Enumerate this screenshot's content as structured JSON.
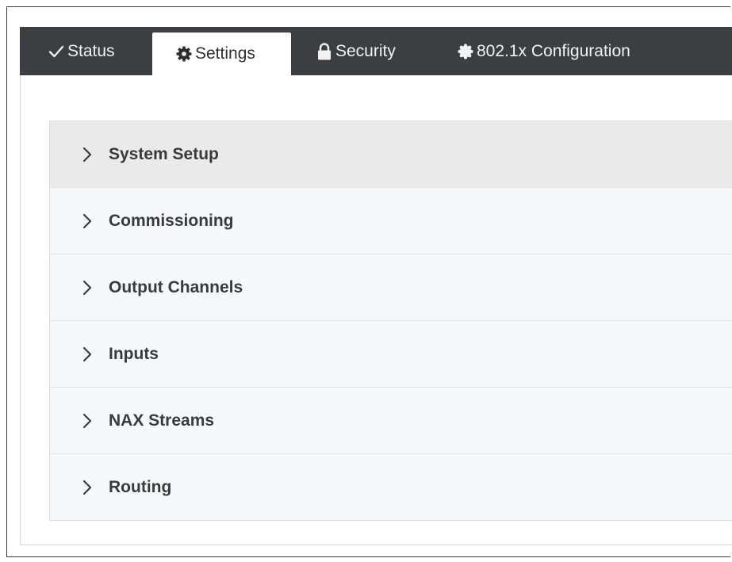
{
  "tabs": [
    {
      "label": "Status",
      "icon": "check-icon"
    },
    {
      "label": "Settings",
      "icon": "gear-icon"
    },
    {
      "label": "Security",
      "icon": "lock-icon"
    },
    {
      "label": "802.1x Configuration",
      "icon": "badge-icon"
    }
  ],
  "active_tab": "Settings",
  "accordion": {
    "items": [
      {
        "label": "System Setup"
      },
      {
        "label": "Commissioning"
      },
      {
        "label": "Output Channels"
      },
      {
        "label": "Inputs"
      },
      {
        "label": "NAX Streams"
      },
      {
        "label": "Routing"
      }
    ]
  },
  "colors": {
    "tabbar_bg": "#3b3f43",
    "tab_text": "#f2f2f2",
    "active_tab_bg": "#ffffff",
    "accordion_bg": "#f6f9fb",
    "accordion_highlight": "#e8eaec",
    "label_text": "#3a3a3a"
  }
}
